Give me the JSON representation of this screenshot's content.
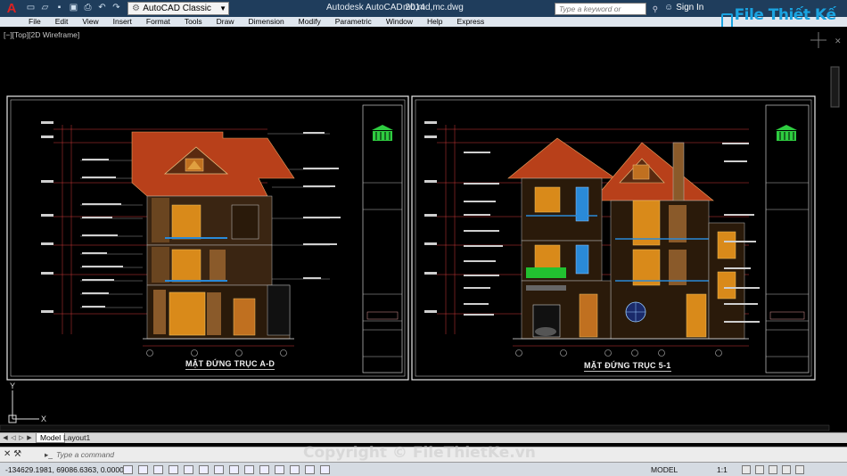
{
  "window": {
    "title": "Autodesk AutoCAD 2014",
    "file": "mb,md,mc.dwg",
    "workspace": "AutoCAD Classic",
    "help_search_placeholder": "Type a keyword or phrase",
    "sign_in": "Sign In"
  },
  "menu": [
    "File",
    "Edit",
    "View",
    "Insert",
    "Format",
    "Tools",
    "Draw",
    "Dimension",
    "Modify",
    "Parametric",
    "Window",
    "Help",
    "Express"
  ],
  "viewport": {
    "label": "[−][Top][2D Wireframe]"
  },
  "sheets": [
    {
      "title": "MẶT ĐỨNG TRỤC A-D"
    },
    {
      "title": "MẶT ĐỨNG TRỤC 5-1"
    }
  ],
  "tabs": {
    "model": "Model",
    "layout": "Layout1"
  },
  "command": {
    "placeholder": "Type a command"
  },
  "status": {
    "coordinates": "-134629.1981, 69086.6363, 0.0000",
    "model": "MODEL",
    "scale": "1:1"
  },
  "watermark": {
    "logo": "File Thiết Kế .vn",
    "copyright": "Copyright © FileThietKe.vn"
  },
  "colors": {
    "roof": "#b8401a",
    "brick": "#8a5a2a",
    "window": "#d98a1a",
    "blue_window": "#2a8ad8",
    "frame_line": "#c8c8c8",
    "dimension": "#e04040",
    "logo_green": "#2ecc40"
  },
  "icons": [
    "autocad-logo-icon",
    "new-icon",
    "open-icon",
    "save-icon",
    "print-icon",
    "undo-icon",
    "redo-icon",
    "search-icon",
    "user-icon",
    "close-icon",
    "viewcube-icon",
    "ucs-icon"
  ]
}
